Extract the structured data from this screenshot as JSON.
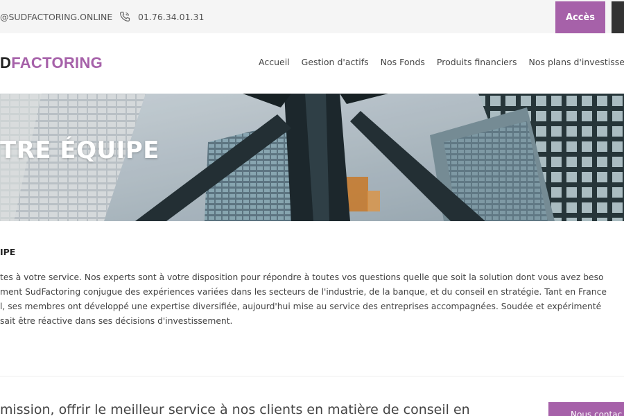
{
  "topbar": {
    "email": "@SUDFACTORING.ONLINE",
    "phone": "01.76.34.01.31",
    "acces_label": "Accès"
  },
  "header": {
    "logo_dark": "D",
    "logo_brand": "FACTORING",
    "nav": [
      "Accueil",
      "Gestion d'actifs",
      "Nos Fonds",
      "Produits financiers",
      "Nos plans d'investisseme"
    ]
  },
  "hero": {
    "title": "TRE ÉQUIPE"
  },
  "content": {
    "heading": "IPE",
    "lines": [
      "tes à votre service. Nos experts sont à votre disposition pour répondre à toutes vos questions quelle que soit la solution dont vous avez beso",
      "ment SudFactoring conjugue des expériences variées dans les secteurs de l'industrie, de la banque, et du conseil en stratégie. Tant en France",
      "l, ses membres ont développé une expertise diversifiée, aujourd'hui mise au service des entreprises accompagnées. Soudée et expérimenté",
      "sait être réactive dans ses décisions d'investissement."
    ]
  },
  "footer_cta": {
    "mission": "mission, offrir le meilleur service à nos clients en matière de conseil en",
    "contact_label": "Nous contac"
  },
  "colors": {
    "accent": "#a661a9",
    "topbar_bg": "#f5f5f5"
  },
  "icons": {
    "phone": "phone-icon"
  }
}
